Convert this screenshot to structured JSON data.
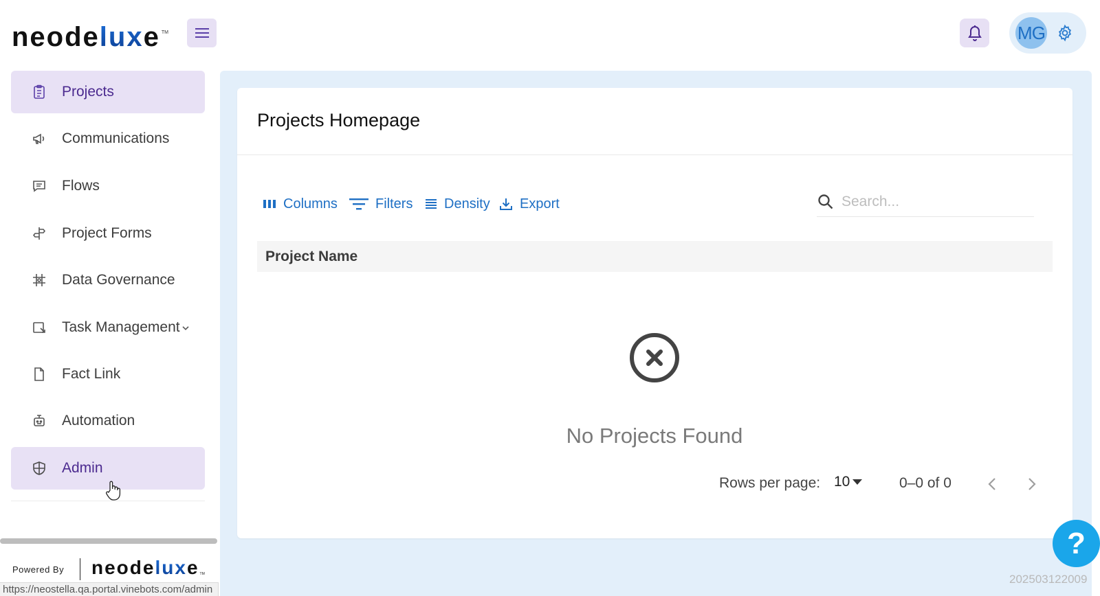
{
  "brand": {
    "logo_main": "neode",
    "logo_accent": "lux",
    "logo_end": "e",
    "tm": "TM"
  },
  "header": {
    "user_initials": "MG"
  },
  "sidebar": {
    "items": [
      {
        "label": "Projects",
        "icon": "clipboard-icon",
        "active": true
      },
      {
        "label": "Communications",
        "icon": "megaphone-icon"
      },
      {
        "label": "Flows",
        "icon": "chat-icon"
      },
      {
        "label": "Project Forms",
        "icon": "signpost-icon"
      },
      {
        "label": "Data Governance",
        "icon": "grid-icon"
      },
      {
        "label": "Task Management",
        "icon": "task-icon",
        "has_chevron": true
      },
      {
        "label": "Fact Link",
        "icon": "document-icon"
      },
      {
        "label": "Automation",
        "icon": "robot-icon"
      },
      {
        "label": "Admin",
        "icon": "shield-icon",
        "active": true
      }
    ],
    "powered_by": "Powered By"
  },
  "status_bar": {
    "url": "https://neostella.qa.portal.vinebots.com/admin"
  },
  "main": {
    "title": "Projects Homepage",
    "toolbar": {
      "columns": "Columns",
      "filters": "Filters",
      "density": "Density",
      "export": "Export"
    },
    "search": {
      "placeholder": "Search..."
    },
    "table": {
      "columns": [
        "Project Name"
      ]
    },
    "empty_message": "No Projects Found",
    "pagination": {
      "rows_per_page_label": "Rows per page:",
      "rows_per_page": "10",
      "range": "0–0 of 0"
    }
  },
  "help": {
    "label": "?"
  },
  "build_id": "202503122009",
  "colors": {
    "accent": "#1e6fc4",
    "active_nav": "#e8e1f5",
    "content_bg": "#e3effa",
    "help": "#1aa6ea"
  }
}
